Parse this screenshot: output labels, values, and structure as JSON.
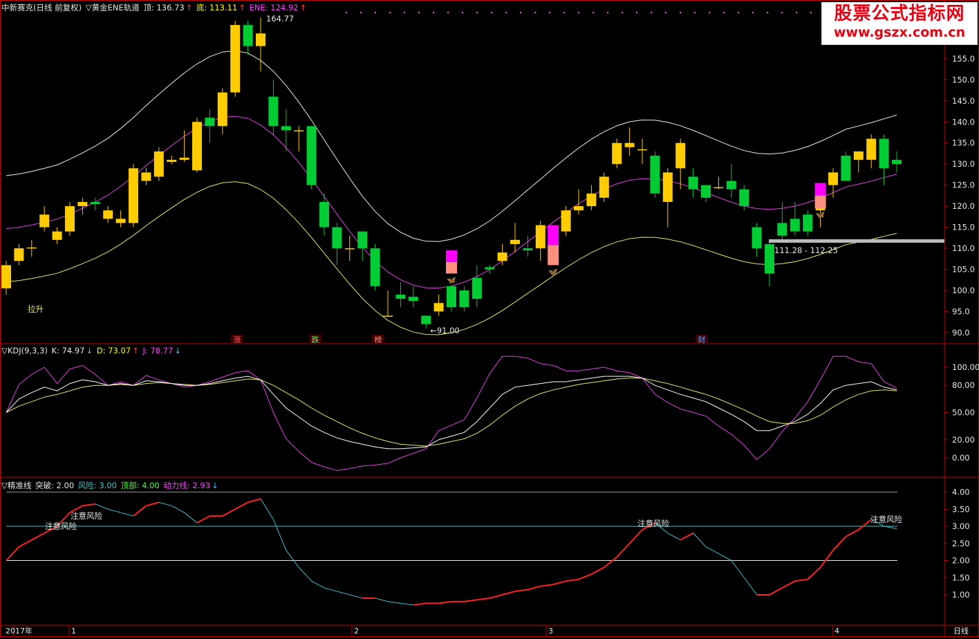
{
  "main_header": {
    "title": "中新赛克(日线 前复权)",
    "indicator": "▽黄金ENE轨道",
    "top_label": "顶: 136.73",
    "top_arrow": "↑",
    "bottom_label": "底: 113.11",
    "bottom_arrow": "↑",
    "ene_label": "ENE: 124.92",
    "ene_arrow": "↑"
  },
  "watermark": {
    "line1": "股票公式指标网",
    "line2": "www.gszx.com.cn"
  },
  "kdj_header": {
    "name": "▽KDJ(9,3,3)",
    "k_label": "K: 74.97",
    "k_arrow": "↓",
    "d_label": "D: 73.07",
    "d_arrow": "↑",
    "j_label": "J: 78.77",
    "j_arrow": "↓"
  },
  "jzx_header": {
    "name": "▽精准线",
    "breakout_label": "突破: 2.00",
    "risk_label": "风险: 3.00",
    "top_label": "顶部: 4.00",
    "momentum_label": "动力线: 2.93",
    "momentum_arrow": "↓"
  },
  "annotations": {
    "high_price": "164.77",
    "low_price": "91.00",
    "lashen": "拉升",
    "range_label": "111.28 - 112.25",
    "tag_zhang": "涨",
    "tag_die": "跌",
    "tag_bang": "榜",
    "tag_cai": "财",
    "risk_notes": [
      "注意风险",
      "注意风险",
      "注意风险",
      "注意风险"
    ]
  },
  "time_axis": {
    "labels": [
      "2017年",
      "1",
      "2",
      "3",
      "4"
    ],
    "period": "日线"
  },
  "price_axis": [
    "155.0",
    "150.0",
    "145.0",
    "140.0",
    "135.0",
    "130.0",
    "125.0",
    "120.0",
    "115.0",
    "110.0",
    "105.0",
    "100.0",
    "95.0",
    "90.0"
  ],
  "kdj_axis": [
    "100.00",
    "80.00",
    "50.00",
    "20.00",
    "0.00"
  ],
  "jzx_axis": [
    "4.00",
    "3.50",
    "3.00",
    "2.50",
    "2.00",
    "1.50",
    "1.00"
  ],
  "colors": {
    "up": "#ffcc00",
    "down": "#00cc33",
    "upper_band": "#f0f0d8",
    "mid_band": "#e040e0",
    "lower_band": "#e8e860",
    "kdj_k": "#ffffff",
    "kdj_d": "#e8e860",
    "kdj_j": "#e040e0",
    "jzx_up": "#ff2020",
    "jzx_down": "#40c0d0",
    "axis": "#c00000",
    "title_white": "#e8e8e8",
    "kdj_yellow": "#ffff00",
    "j_magenta": "#ff40ff",
    "jzx_cyan": "#40c8c8",
    "jzx_green": "#40ff40",
    "jzx_magenta": "#ff40ff"
  },
  "chart_data": [
    {
      "type": "candlestick",
      "title": "中新赛克(日线 前复权)",
      "ylim": [
        88.5,
        165
      ],
      "candles": [
        [
          100.5,
          106,
          99,
          107
        ],
        [
          107,
          110,
          106,
          111
        ],
        [
          110,
          110.2,
          108,
          112
        ],
        [
          115,
          118,
          114,
          120
        ],
        [
          112,
          114,
          111,
          115
        ],
        [
          114,
          120,
          113,
          121
        ],
        [
          120,
          121,
          118,
          122
        ],
        [
          121,
          120.5,
          119,
          122
        ],
        [
          117,
          119,
          116,
          120
        ],
        [
          116,
          117,
          115,
          119
        ],
        [
          116,
          129,
          115,
          130
        ],
        [
          126,
          128,
          125,
          129
        ],
        [
          127,
          133,
          126,
          134
        ],
        [
          130.5,
          131,
          130,
          132
        ],
        [
          131,
          131.5,
          130.5,
          138
        ],
        [
          128.5,
          140,
          128,
          141
        ],
        [
          141,
          139,
          135,
          143
        ],
        [
          139,
          147,
          137,
          148
        ],
        [
          147,
          163,
          146,
          164
        ],
        [
          163,
          158,
          156,
          164
        ],
        [
          158,
          161,
          152,
          164.77
        ],
        [
          146,
          139,
          137,
          150
        ],
        [
          139,
          138,
          133,
          143
        ],
        [
          138,
          138,
          133,
          139
        ],
        [
          139,
          125,
          124,
          139
        ],
        [
          121,
          115,
          113,
          123
        ],
        [
          115,
          110,
          106,
          116
        ],
        [
          110,
          110,
          107,
          113
        ],
        [
          114,
          110,
          107,
          114
        ],
        [
          110,
          101,
          100,
          111
        ],
        [
          94,
          94,
          94,
          100
        ],
        [
          99,
          98,
          96,
          102
        ],
        [
          98.5,
          97.5,
          96,
          101
        ],
        [
          94,
          92,
          91,
          94
        ],
        [
          95,
          97,
          94,
          99
        ],
        [
          101,
          96,
          95,
          101
        ],
        [
          100,
          96,
          95,
          101
        ],
        [
          103,
          98,
          96,
          106
        ],
        [
          105.5,
          105,
          104,
          106
        ],
        [
          107,
          109,
          106,
          111
        ],
        [
          111,
          112,
          109,
          116
        ],
        [
          110,
          109.5,
          108,
          113
        ],
        [
          110,
          115.5,
          107,
          116.5
        ],
        [
          113,
          112.5,
          112,
          115
        ],
        [
          114,
          119,
          113,
          120
        ],
        [
          119,
          120,
          118,
          124
        ],
        [
          120,
          123,
          119,
          125
        ],
        [
          122,
          127,
          121,
          128
        ],
        [
          130,
          135,
          129,
          136
        ],
        [
          134,
          135,
          132,
          138.7
        ],
        [
          133.5,
          133.5,
          130,
          136
        ],
        [
          132,
          123,
          122,
          133
        ],
        [
          121,
          128,
          115,
          129
        ],
        [
          129,
          135,
          124,
          136
        ],
        [
          127,
          124,
          122,
          129
        ],
        [
          125,
          122,
          121,
          125
        ],
        [
          124.5,
          124.5,
          124,
          127
        ],
        [
          126,
          124,
          122,
          130
        ],
        [
          124,
          120,
          119,
          125
        ],
        [
          115,
          110,
          108,
          116
        ],
        [
          111,
          104,
          101,
          112
        ],
        [
          116,
          113,
          112,
          121
        ],
        [
          117,
          114,
          113,
          121
        ],
        [
          118,
          114,
          113,
          119
        ],
        [
          119,
          124,
          115,
          125
        ],
        [
          125,
          128,
          122,
          129
        ],
        [
          132,
          126,
          126,
          133
        ],
        [
          131,
          133,
          128,
          133
        ],
        [
          131,
          136,
          129,
          137
        ],
        [
          136,
          129,
          125,
          137
        ],
        [
          131,
          130,
          128,
          133
        ]
      ]
    }
  ]
}
